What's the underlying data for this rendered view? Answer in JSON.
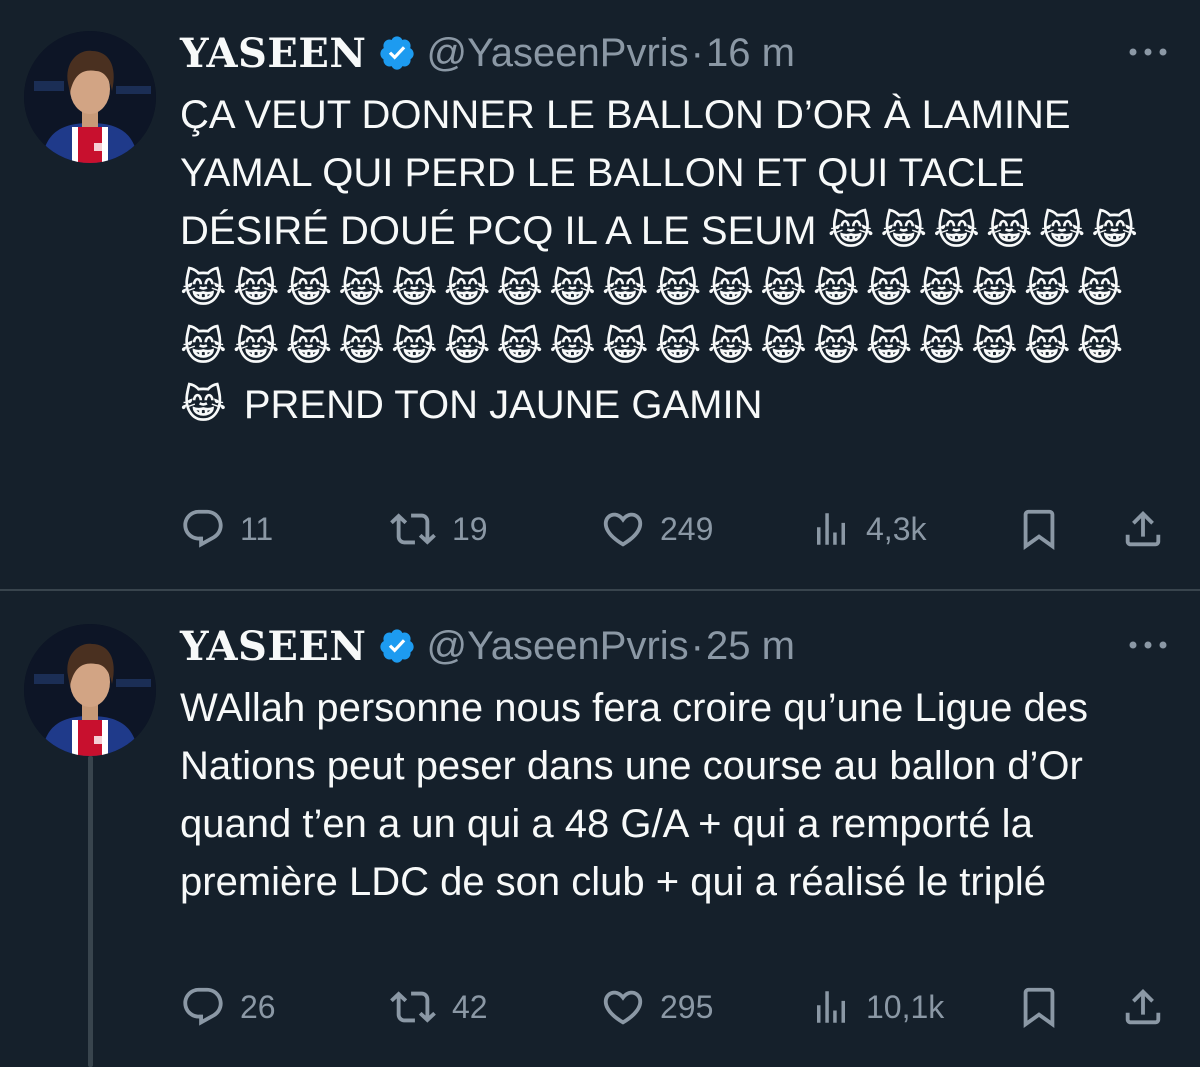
{
  "tweets": [
    {
      "display_name": "YASEEN",
      "handle": "@YaseenPvris",
      "separator": "·",
      "time": "16 m",
      "text_main": "ÇA VEUT DONNER LE BALLON D’OR À LAMINE YAMAL QUI PERD LE BALLON ET QUI TACLE DÉSIRÉ DOUÉ PCQ IL A LE SEUM",
      "emojis": "😹😹😹😹😹😹😹😹😹😹😹😹😹😹😹😹😹😹😹😹😹😹😹😹😹😹😹😹😹😹😹😹😹😹😹😹😹😹😹😹😹😹😹",
      "text_end": " PREND TON JAUNE GAMIN",
      "replies": "11",
      "retweets": "19",
      "likes": "249",
      "views": "4,3k"
    },
    {
      "display_name": "YASEEN",
      "handle": "@YaseenPvris",
      "separator": "·",
      "time": "25 m",
      "text_main": "WAllah personne nous fera croire qu’une Ligue des Nations peut peser dans une course au ballon d’Or quand t’en a un qui a 48 G/A + qui a remporté la première LDC de son club + qui a réalisé le triplé",
      "replies": "26",
      "retweets": "42",
      "likes": "295",
      "views": "10,1k"
    }
  ],
  "icons": {
    "verified": "verified-badge-icon",
    "more": "more-icon",
    "reply": "reply-icon",
    "retweet": "retweet-icon",
    "like": "heart-icon",
    "views": "views-icon",
    "bookmark": "bookmark-icon",
    "share": "share-icon"
  },
  "colors": {
    "background": "#15202b",
    "text": "#f7f9f9",
    "muted": "#8b98a5",
    "verified": "#1d9bf0",
    "divider": "#38444d"
  }
}
